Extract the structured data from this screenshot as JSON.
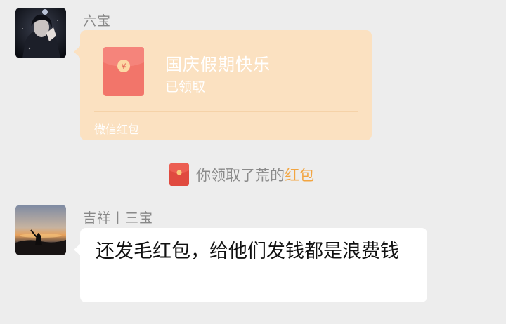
{
  "messages": [
    {
      "sender": "六宝",
      "avatar_icon": "person-hooded-avatar",
      "red_packet": {
        "title": "国庆假期快乐",
        "status": "已领取",
        "footer": "微信红包"
      }
    },
    {
      "sender": "吉祥丨三宝",
      "avatar_icon": "sunset-mountain-avatar",
      "text": "还发毛红包，给他们发钱都是浪费钱"
    }
  ],
  "notice": {
    "prefix": "你领取了荒的",
    "link": "红包",
    "icon": "red-packet-icon"
  },
  "colors": {
    "background": "#ededed",
    "red_packet_bubble": "#fbe1c1",
    "red_packet_icon": "#f0625a",
    "link": "#f2a541"
  }
}
